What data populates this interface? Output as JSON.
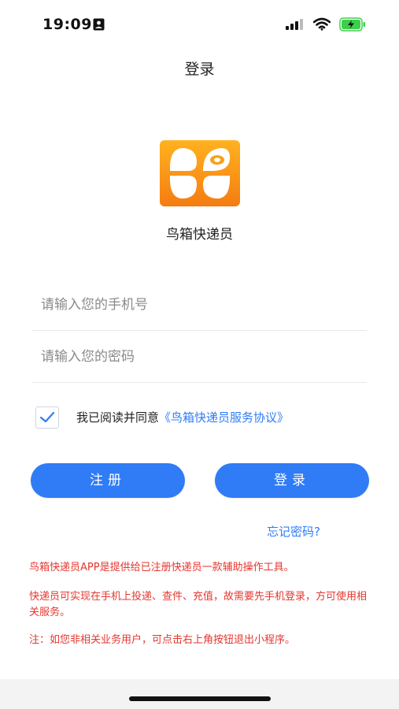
{
  "status_bar": {
    "time": "19:09",
    "icons": [
      "id-card-icon",
      "signal-icon",
      "wifi-icon",
      "battery-charging-icon"
    ]
  },
  "nav": {
    "title": "登录"
  },
  "app": {
    "name": "鸟箱快递员",
    "logo_icon": "app-logo-icon",
    "logo_colors": {
      "gradient_top": "#ffb21f",
      "gradient_bottom": "#f57c12",
      "petal": "#ffffff"
    }
  },
  "form": {
    "phone_placeholder": "请输入您的手机号",
    "phone_value": "",
    "password_placeholder": "请输入您的密码",
    "password_value": "",
    "agreement": {
      "checked": true,
      "text": "我已阅读并同意",
      "link_text": "《鸟箱快递员服务协议》"
    },
    "register_label": "注册",
    "login_label": "登录",
    "forgot_password": "忘记密码?"
  },
  "notices": [
    "鸟箱快递员APP是提供给已注册快递员一款辅助操作工具。",
    "快递员可实现在手机上投递、查件、充值，故需要先手机登录，方可使用相关服务。",
    "注：如您非相关业务用户，可点击右上角按钮退出小程序。"
  ],
  "colors": {
    "accent": "#2f7cf6",
    "notice": "#e5372f",
    "battery": "#3ecf4a"
  }
}
